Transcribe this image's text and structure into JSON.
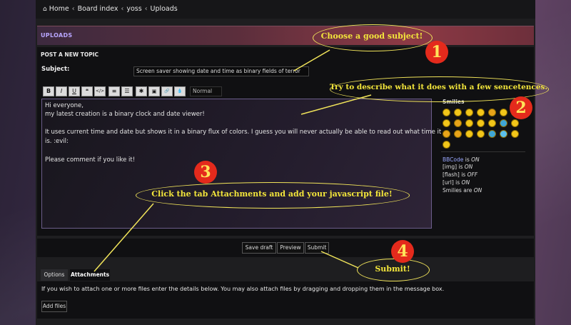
{
  "breadcrumb": {
    "items": [
      "Home",
      "Board index",
      "yoss",
      "Uploads"
    ]
  },
  "forum_title": "UPLOADS",
  "post_section_title": "POST A NEW TOPIC",
  "subject": {
    "label": "Subject:",
    "value": "Screen saver showing date and time as binary fields of terror"
  },
  "toolbar": {
    "buttons": [
      "B",
      "I",
      "U",
      "❝",
      "</>",
      "≡",
      "☰",
      "✱",
      "▣",
      "🔗",
      "💧"
    ],
    "font_size": "Normal"
  },
  "message": {
    "lines": [
      "Hi everyone,",
      "my latest creation is a binary clock and date viewer!",
      "",
      "It uses current time and date but shows it in a binary flux of colors. I guess you will never actually be able to read out what time it",
      "is.  :evil:",
      "",
      "Please comment if you like it!"
    ]
  },
  "smilies": {
    "title": "Smilies"
  },
  "status": {
    "bbcode_prefix": "BBCode",
    "bbcode_suffix": " is ",
    "bbcode_value": "ON",
    "img_prefix": "[img] is ",
    "img_value": "ON",
    "flash_prefix": "[flash] is ",
    "flash_value": "OFF",
    "url_prefix": "[url] is ",
    "url_value": "ON",
    "smilies_prefix": "Smilies are ",
    "smilies_value": "ON"
  },
  "buttons": {
    "save_draft": "Save draft",
    "preview": "Preview",
    "submit": "Submit"
  },
  "tabs": {
    "options": "Options",
    "attachments": "Attachments"
  },
  "attachments": {
    "text": "If you wish to attach one or more files enter the details below. You may also attach files by dragging and dropping them in the message box.",
    "add_files": "Add files"
  },
  "annotations": {
    "a1": "Choose a good subject!",
    "a2": "Try to describe what it does with a few sencetences.",
    "a3": "Click the tab Attachments and add your javascript file!",
    "a4": "Submit!",
    "n1": "1",
    "n2": "2",
    "n3": "3",
    "n4": "4"
  },
  "colors": {
    "annotation": "#f1e45a",
    "number_badge": "#e42a1c",
    "link": "#9aa8ff",
    "uploads_title": "#b9a6ff"
  }
}
